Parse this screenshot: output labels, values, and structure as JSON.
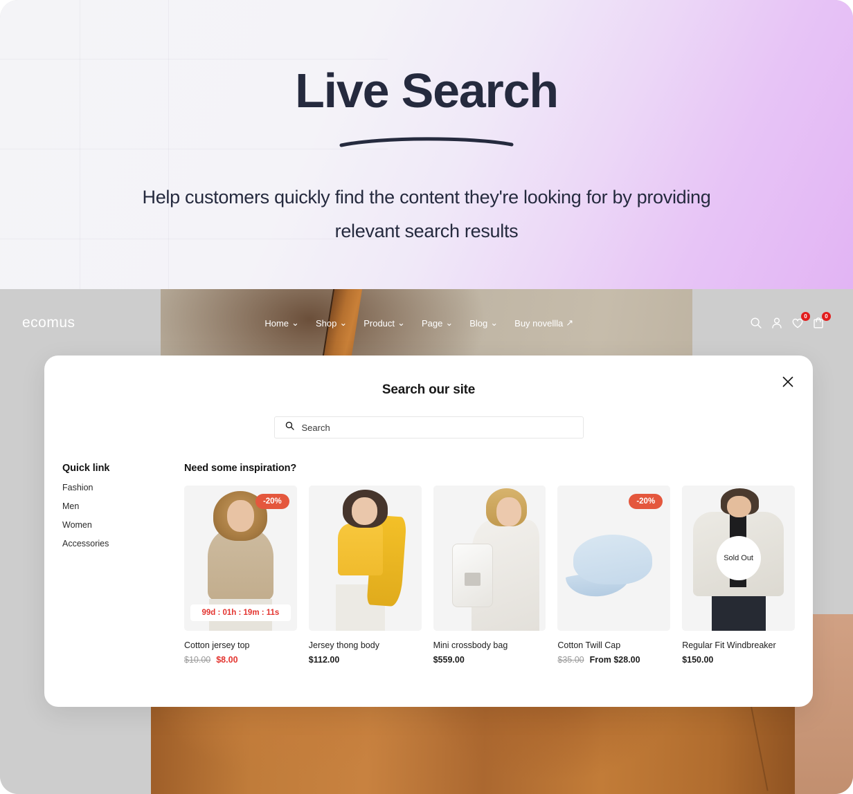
{
  "hero": {
    "title": "Live Search",
    "subtitle": "Help customers quickly find the content they're looking for by providing relevant search results"
  },
  "navbar": {
    "logo": "ecomus",
    "menu": [
      {
        "label": "Home",
        "caret": "⌄"
      },
      {
        "label": "Shop",
        "caret": "⌄"
      },
      {
        "label": "Product",
        "caret": "⌄"
      },
      {
        "label": "Page",
        "caret": "⌄"
      },
      {
        "label": "Blog",
        "caret": "⌄"
      },
      {
        "label": "Buy novellla",
        "caret": "↗"
      }
    ],
    "icons": [
      {
        "name": "search-icon",
        "badge": null
      },
      {
        "name": "user-icon",
        "badge": null
      },
      {
        "name": "wishlist-heart-icon",
        "badge": "0"
      },
      {
        "name": "cart-bag-icon",
        "badge": "0"
      }
    ],
    "badge_color": "#e21d1d"
  },
  "modal": {
    "title": "Search our site",
    "close_label": "✕",
    "search": {
      "placeholder": "Search",
      "value": "",
      "icon": "search-icon"
    },
    "quick_link": {
      "title": "Quick link",
      "items": [
        "Fashion",
        "Men",
        "Women",
        "Accessories"
      ]
    },
    "results": {
      "title": "Need some inspiration?",
      "products": [
        {
          "name": "Cotton jersey top",
          "badge": "-20%",
          "countdown": "99d : 01h : 19m : 11s",
          "sold_out": null,
          "old_price": "$10.00",
          "price": "$8.00",
          "price_is_sale": true
        },
        {
          "name": "Jersey thong body",
          "badge": null,
          "countdown": null,
          "sold_out": null,
          "old_price": null,
          "price": "$112.00",
          "price_is_sale": false
        },
        {
          "name": "Mini crossbody bag",
          "badge": null,
          "countdown": null,
          "sold_out": null,
          "old_price": null,
          "price": "$559.00",
          "price_is_sale": false
        },
        {
          "name": "Cotton Twill Cap",
          "badge": "-20%",
          "countdown": null,
          "sold_out": null,
          "old_price": "$35.00",
          "price": "From $28.00",
          "price_is_sale": false
        },
        {
          "name": "Regular Fit Windbreaker",
          "badge": null,
          "countdown": null,
          "sold_out": "Sold Out",
          "old_price": null,
          "price": "$150.00",
          "price_is_sale": false
        }
      ]
    }
  },
  "colors": {
    "sale_red": "#e3342f",
    "badge_orange": "#e4573d",
    "heading_navy": "#252a3e",
    "gradient_start": "#f4f4f7",
    "gradient_end": "#e2b4f4"
  }
}
